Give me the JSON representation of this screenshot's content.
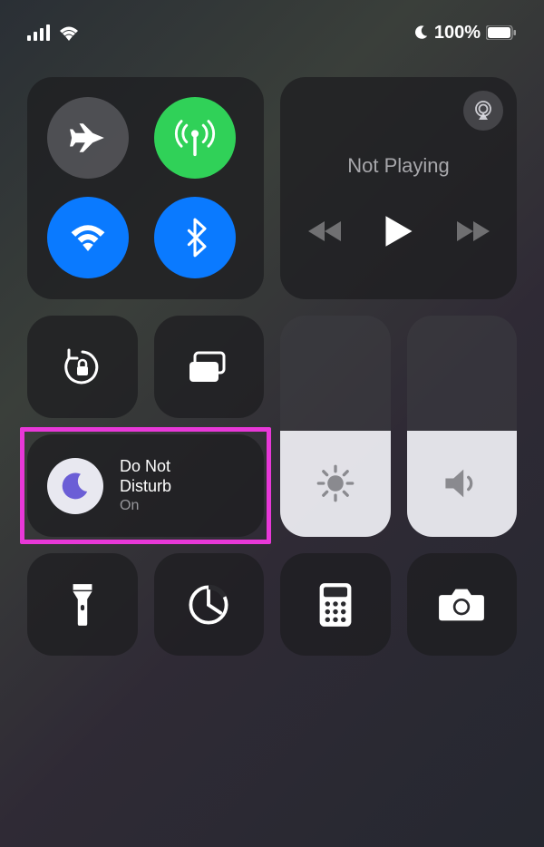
{
  "status": {
    "battery_pct": "100%"
  },
  "media": {
    "not_playing": "Not Playing"
  },
  "dnd": {
    "title_line1": "Do Not",
    "title_line2": "Disturb",
    "status": "On"
  },
  "sliders": {
    "brightness_pct": 48,
    "volume_pct": 48
  },
  "colors": {
    "highlight": "#e838d8",
    "blue": "#0a7aff",
    "green": "#30d158",
    "moon": "#6b5ed6"
  }
}
